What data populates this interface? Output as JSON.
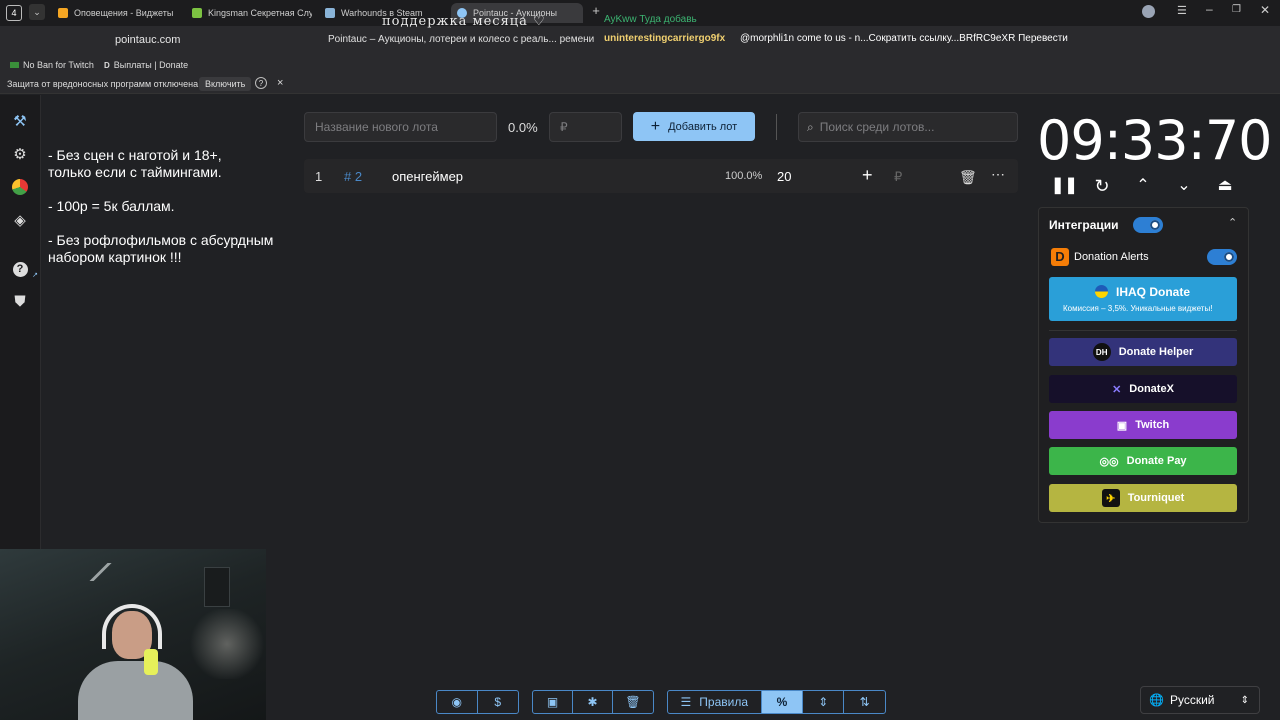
{
  "browser": {
    "tab_counter": "4",
    "tabs": [
      {
        "label": "Оповещения - Виджеты",
        "color": "#f5a623"
      },
      {
        "label": "Kingsman Секретная Слу",
        "color": "#7cc242"
      },
      {
        "label": "Warhounds в Steam",
        "color": "#8ab4d8"
      },
      {
        "label": "Pointauc - Аукционы",
        "color": "#8ec5f5",
        "active": true
      }
    ],
    "url": "pointauc.com",
    "page_title": "Pointauc – Аукционы, лотереи и колесо с реаль... ремени",
    "bookmarks": [
      "No Ban for Twitch",
      "Выплаты | Donate"
    ],
    "security_text": "Защита от вредоносных программ отключена",
    "security_button": "Включить",
    "close_label": "×"
  },
  "overlay": {
    "line1": "поддержка месяца ♡",
    "line2": "AyKww  Туда добавь",
    "user": "uninterestingcarriergo9fx",
    "message": "@morphli1n come to us - n...Сократить ссылку...BRfRC9eXR  Перевести"
  },
  "sidebar": {
    "icons": [
      "auction-icon",
      "settings-icon",
      "pie-chart-icon",
      "layers-icon",
      "help-icon",
      "shield-icon"
    ]
  },
  "rules_text": "- Без сцен с наготой и 18+,\nтолько если с таймингами.\n\n- 100р = 5к баллам.\n\n- Без рофлофильмов с абсурдным\nнабором картинок !!!",
  "lot_form": {
    "name_placeholder": "Название нового лота",
    "percent": "0.0%",
    "amount_placeholder": "₽",
    "add_button": "Добавить лот",
    "search_placeholder": "Поиск среди лотов..."
  },
  "lots": [
    {
      "index": "1",
      "id": "# 2",
      "name": "опенгеймер",
      "percent": "100.0%",
      "amount": "20",
      "currency": "₽"
    }
  ],
  "timer": "09:33:70",
  "integrations": {
    "title": "Интеграции",
    "donation_alerts": "Donation Alerts",
    "ihaq_title": "IHAQ Donate",
    "ihaq_sub": "Комиссия – 3,5%. Уникальные виджеты!",
    "buttons": [
      {
        "label": "Donate Helper",
        "bg": "#33337a"
      },
      {
        "label": "DonateX",
        "bg": "#16102a"
      },
      {
        "label": "Twitch",
        "bg": "#8a3ccd"
      },
      {
        "label": "Donate Pay",
        "bg": "#3cb54a"
      },
      {
        "label": "Tourniquet",
        "bg": "#b5b541"
      }
    ]
  },
  "toolbar": {
    "rules_label": "Правила",
    "language": "Русский"
  }
}
